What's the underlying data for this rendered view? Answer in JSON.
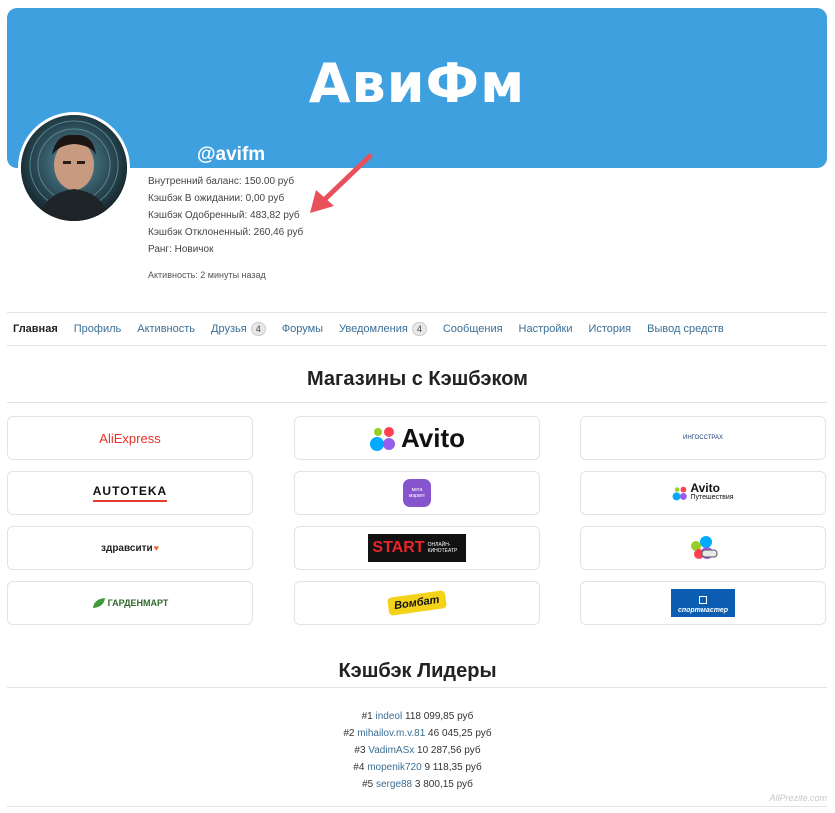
{
  "header": {
    "site_name": "АвиФм",
    "username": "@avifm"
  },
  "profile": {
    "balance": "Внутренний баланс: 150.00 руб",
    "pending": "Кэшбэк В ожидании: 0,00 руб",
    "approved": "Кэшбэк Одобренный: 483,82 руб",
    "rejected": "Кэшбэк Отклоненный: 260,46 руб",
    "rank": "Ранг: Новичок",
    "activity": "Активность: 2 минуты назад"
  },
  "nav": {
    "items": [
      {
        "label": "Главная"
      },
      {
        "label": "Профиль"
      },
      {
        "label": "Активность"
      },
      {
        "label": "Друзья",
        "badge": "4"
      },
      {
        "label": "Форумы"
      },
      {
        "label": "Уведомления",
        "badge": "4"
      },
      {
        "label": "Сообщения"
      },
      {
        "label": "Настройки"
      },
      {
        "label": "История"
      },
      {
        "label": "Вывод средств"
      }
    ]
  },
  "stores": {
    "title": "Магазины с Кэшбэком",
    "items": [
      {
        "label": "AliExpress"
      },
      {
        "label": "Avito"
      },
      {
        "label": "ИНГОССТРАХ"
      },
      {
        "label": "AUTOTEKA"
      },
      {
        "label": "мега маркет"
      },
      {
        "label": "Avito",
        "sub": "Путешествия"
      },
      {
        "label": "здравсити"
      },
      {
        "label": "START",
        "sub": "ОНЛАЙН-КИНОТЕАТР"
      },
      {
        "label": ""
      },
      {
        "label": "ГАРДЕНМАРТ"
      },
      {
        "label": "Вомбат"
      },
      {
        "label": "спортмастер"
      }
    ]
  },
  "leaders": {
    "title": "Кэшбэк Лидеры",
    "items": [
      {
        "rank": "#1",
        "name": "indeol",
        "amount": "118 099,85 руб"
      },
      {
        "rank": "#2",
        "name": "mihailov.m.v.81",
        "amount": "46 045,25 руб"
      },
      {
        "rank": "#3",
        "name": "VadimASx",
        "amount": "10 287,56 руб"
      },
      {
        "rank": "#4",
        "name": "mopenik720",
        "amount": "9 118,35 руб"
      },
      {
        "rank": "#5",
        "name": "serge88",
        "amount": "3 800,15 руб"
      }
    ]
  },
  "watermark": "AllPrezite.com",
  "colors": {
    "cover": "#3fa0e0",
    "link": "#3a6f95",
    "arrow": "#e8505b"
  }
}
